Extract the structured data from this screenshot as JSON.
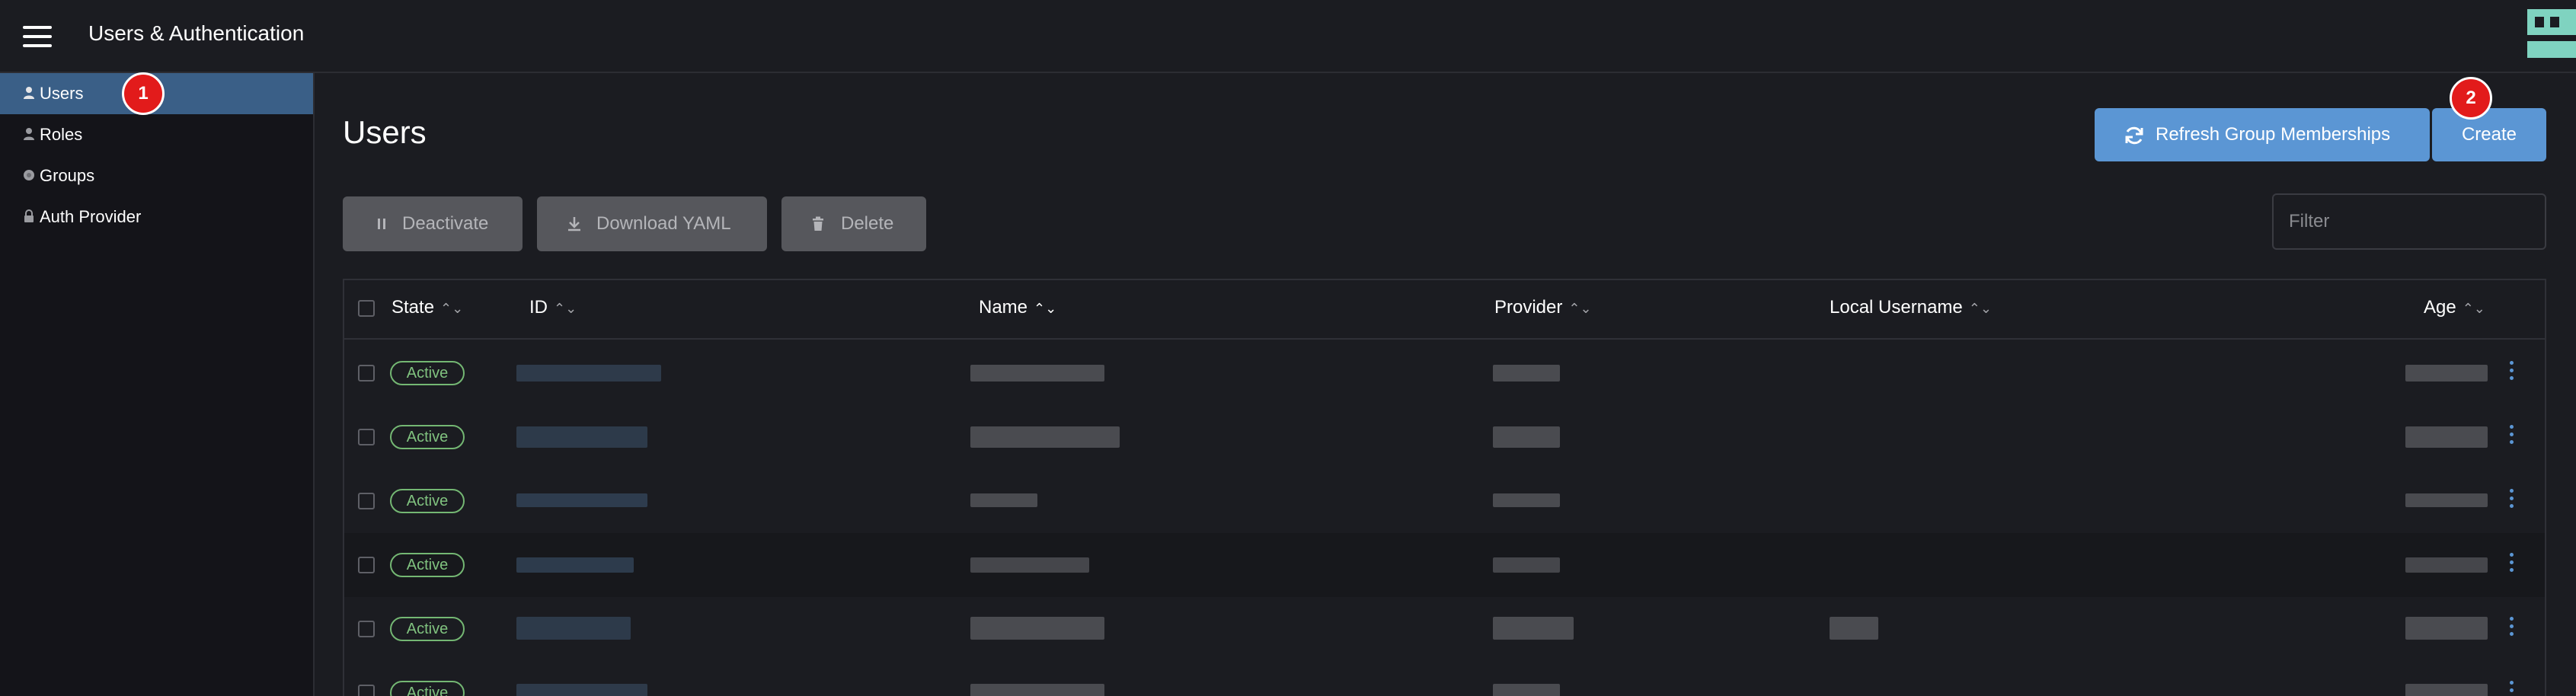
{
  "header": {
    "title": "Users & Authentication"
  },
  "sidebar": {
    "items": [
      {
        "label": "Users",
        "icon": "user-icon",
        "active": true
      },
      {
        "label": "Roles",
        "icon": "user-icon",
        "active": false
      },
      {
        "label": "Groups",
        "icon": "group-icon",
        "active": false
      },
      {
        "label": "Auth Provider",
        "icon": "lock-icon",
        "active": false
      }
    ]
  },
  "badges": {
    "first": "1",
    "second": "2"
  },
  "main": {
    "title": "Users",
    "refresh_label": "Refresh Group Memberships",
    "create_label": "Create",
    "deactivate_label": "Deactivate",
    "download_label": "Download YAML",
    "delete_label": "Delete",
    "filter_placeholder": "Filter"
  },
  "table": {
    "columns": [
      "State",
      "ID",
      "Name",
      "Provider",
      "Local Username",
      "Age"
    ],
    "rows": [
      {
        "state": "Active"
      },
      {
        "state": "Active"
      },
      {
        "state": "Active"
      },
      {
        "state": "Active"
      },
      {
        "state": "Active"
      },
      {
        "state": "Active"
      }
    ]
  },
  "colors": {
    "accent": "#5b96d4",
    "sidebar_active": "#3a5f87",
    "active_badge": "#74b773",
    "step_badge": "#e21b1b"
  }
}
